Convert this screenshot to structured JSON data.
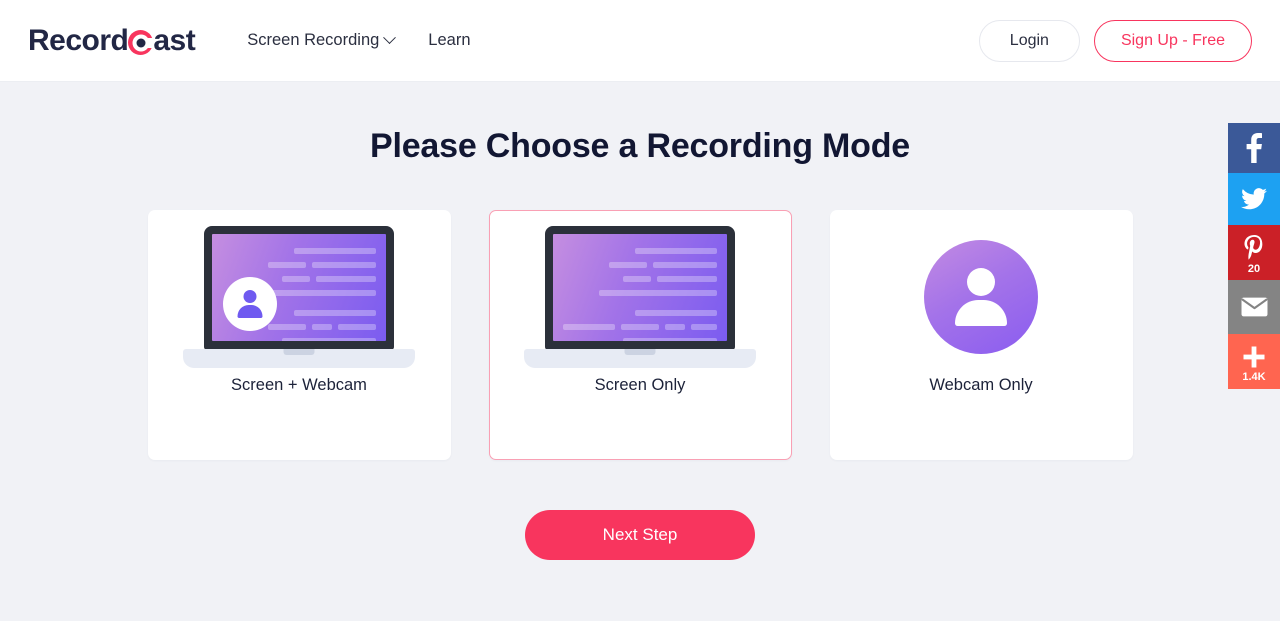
{
  "header": {
    "logo": {
      "text_before": "Record",
      "mark": "record-dot-icon",
      "text_after": "ast"
    },
    "nav": [
      {
        "label": "Screen Recording",
        "has_dropdown": true,
        "icon": "chevron-down-icon"
      },
      {
        "label": "Learn",
        "has_dropdown": false
      }
    ],
    "login_label": "Login",
    "signup_label": "Sign Up - Free"
  },
  "main": {
    "title": "Please Choose a Recording Mode",
    "cards": [
      {
        "label": "Screen + Webcam",
        "art": "laptop-with-webcam",
        "selected": false
      },
      {
        "label": "Screen Only",
        "art": "laptop",
        "selected": true
      },
      {
        "label": "Webcam Only",
        "art": "webcam-avatar",
        "selected": false
      }
    ],
    "next_label": "Next Step"
  },
  "social_rail": [
    {
      "name": "facebook",
      "icon": "facebook-icon",
      "glyph": "f",
      "count": "",
      "color": "#3b5998"
    },
    {
      "name": "twitter",
      "icon": "twitter-icon",
      "glyph": "ᵛ",
      "count": "",
      "color": "#1da1f2"
    },
    {
      "name": "pinterest",
      "icon": "pinterest-icon",
      "glyph": "P",
      "count": "20",
      "color": "#cb2027"
    },
    {
      "name": "email",
      "icon": "envelope-icon",
      "glyph": "✉",
      "count": "",
      "color": "#848484"
    },
    {
      "name": "addthis",
      "icon": "plus-icon",
      "glyph": "+",
      "count": "1.4K",
      "color": "#ff6550"
    }
  ],
  "colors": {
    "brand_pink": "#f8355e",
    "page_bg": "#f1f2f6",
    "text_dark": "#1c2239",
    "screen_purple_start": "#c58ee0",
    "screen_purple_end": "#7b5cf0"
  }
}
